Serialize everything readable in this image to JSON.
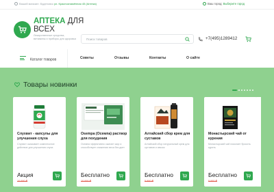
{
  "topbar": {
    "location_prefix": "Ваший магазин: Буденовск ",
    "location_link": "ул. Краснознамённая 45 (Аптека)",
    "city_prefix": "Ваш город: ",
    "city_link": "Выберите город"
  },
  "header": {
    "logo_title_main": "АПТЕКА",
    "logo_title_rest": " ДЛЯ ВСЕХ",
    "logo_subtitle": "Лекарственные средства, витамины и приборы для здоровья",
    "search_placeholder": "Поиск товаров",
    "phone": "+7(495)1289412"
  },
  "nav": {
    "catalog_label": "Каталог товаров",
    "items": [
      "Советы",
      "Отзывы",
      "Контакты",
      "О сайте"
    ]
  },
  "section": {
    "title": "Товары новинки",
    "pager_count": 7,
    "pager_active": 0
  },
  "products": [
    {
      "name": "Слухвит - капсулы для улучшения слуха",
      "desc": "Слухвит оказывает комплексное действие для улучшения слуха",
      "price": "Акция",
      "old_price": "10 990 ₽"
    },
    {
      "name": "Osempa (Осемпа) раствор для похудения",
      "desc": "Осемпа эффективно сжигает жир и способствует снижению веса без диет",
      "price": "Бесплатно",
      "old_price": "10 990 ₽"
    },
    {
      "name": "Алтайский сбор крем для суставов",
      "desc": "Алтайский сбор натуральный крем для суставов и связок",
      "price": "Бесплатно",
      "old_price": "5 990 ₽"
    },
    {
      "name": "Монастырский чай от курения",
      "desc": "Монастырский чай помогает бросить курить",
      "price": "Бесплатно",
      "old_price": "5 990 ₽"
    }
  ],
  "colors": {
    "brand_green": "#2fa84f",
    "section_bg": "#8fd18f",
    "old_price_red": "#e05a4a"
  }
}
